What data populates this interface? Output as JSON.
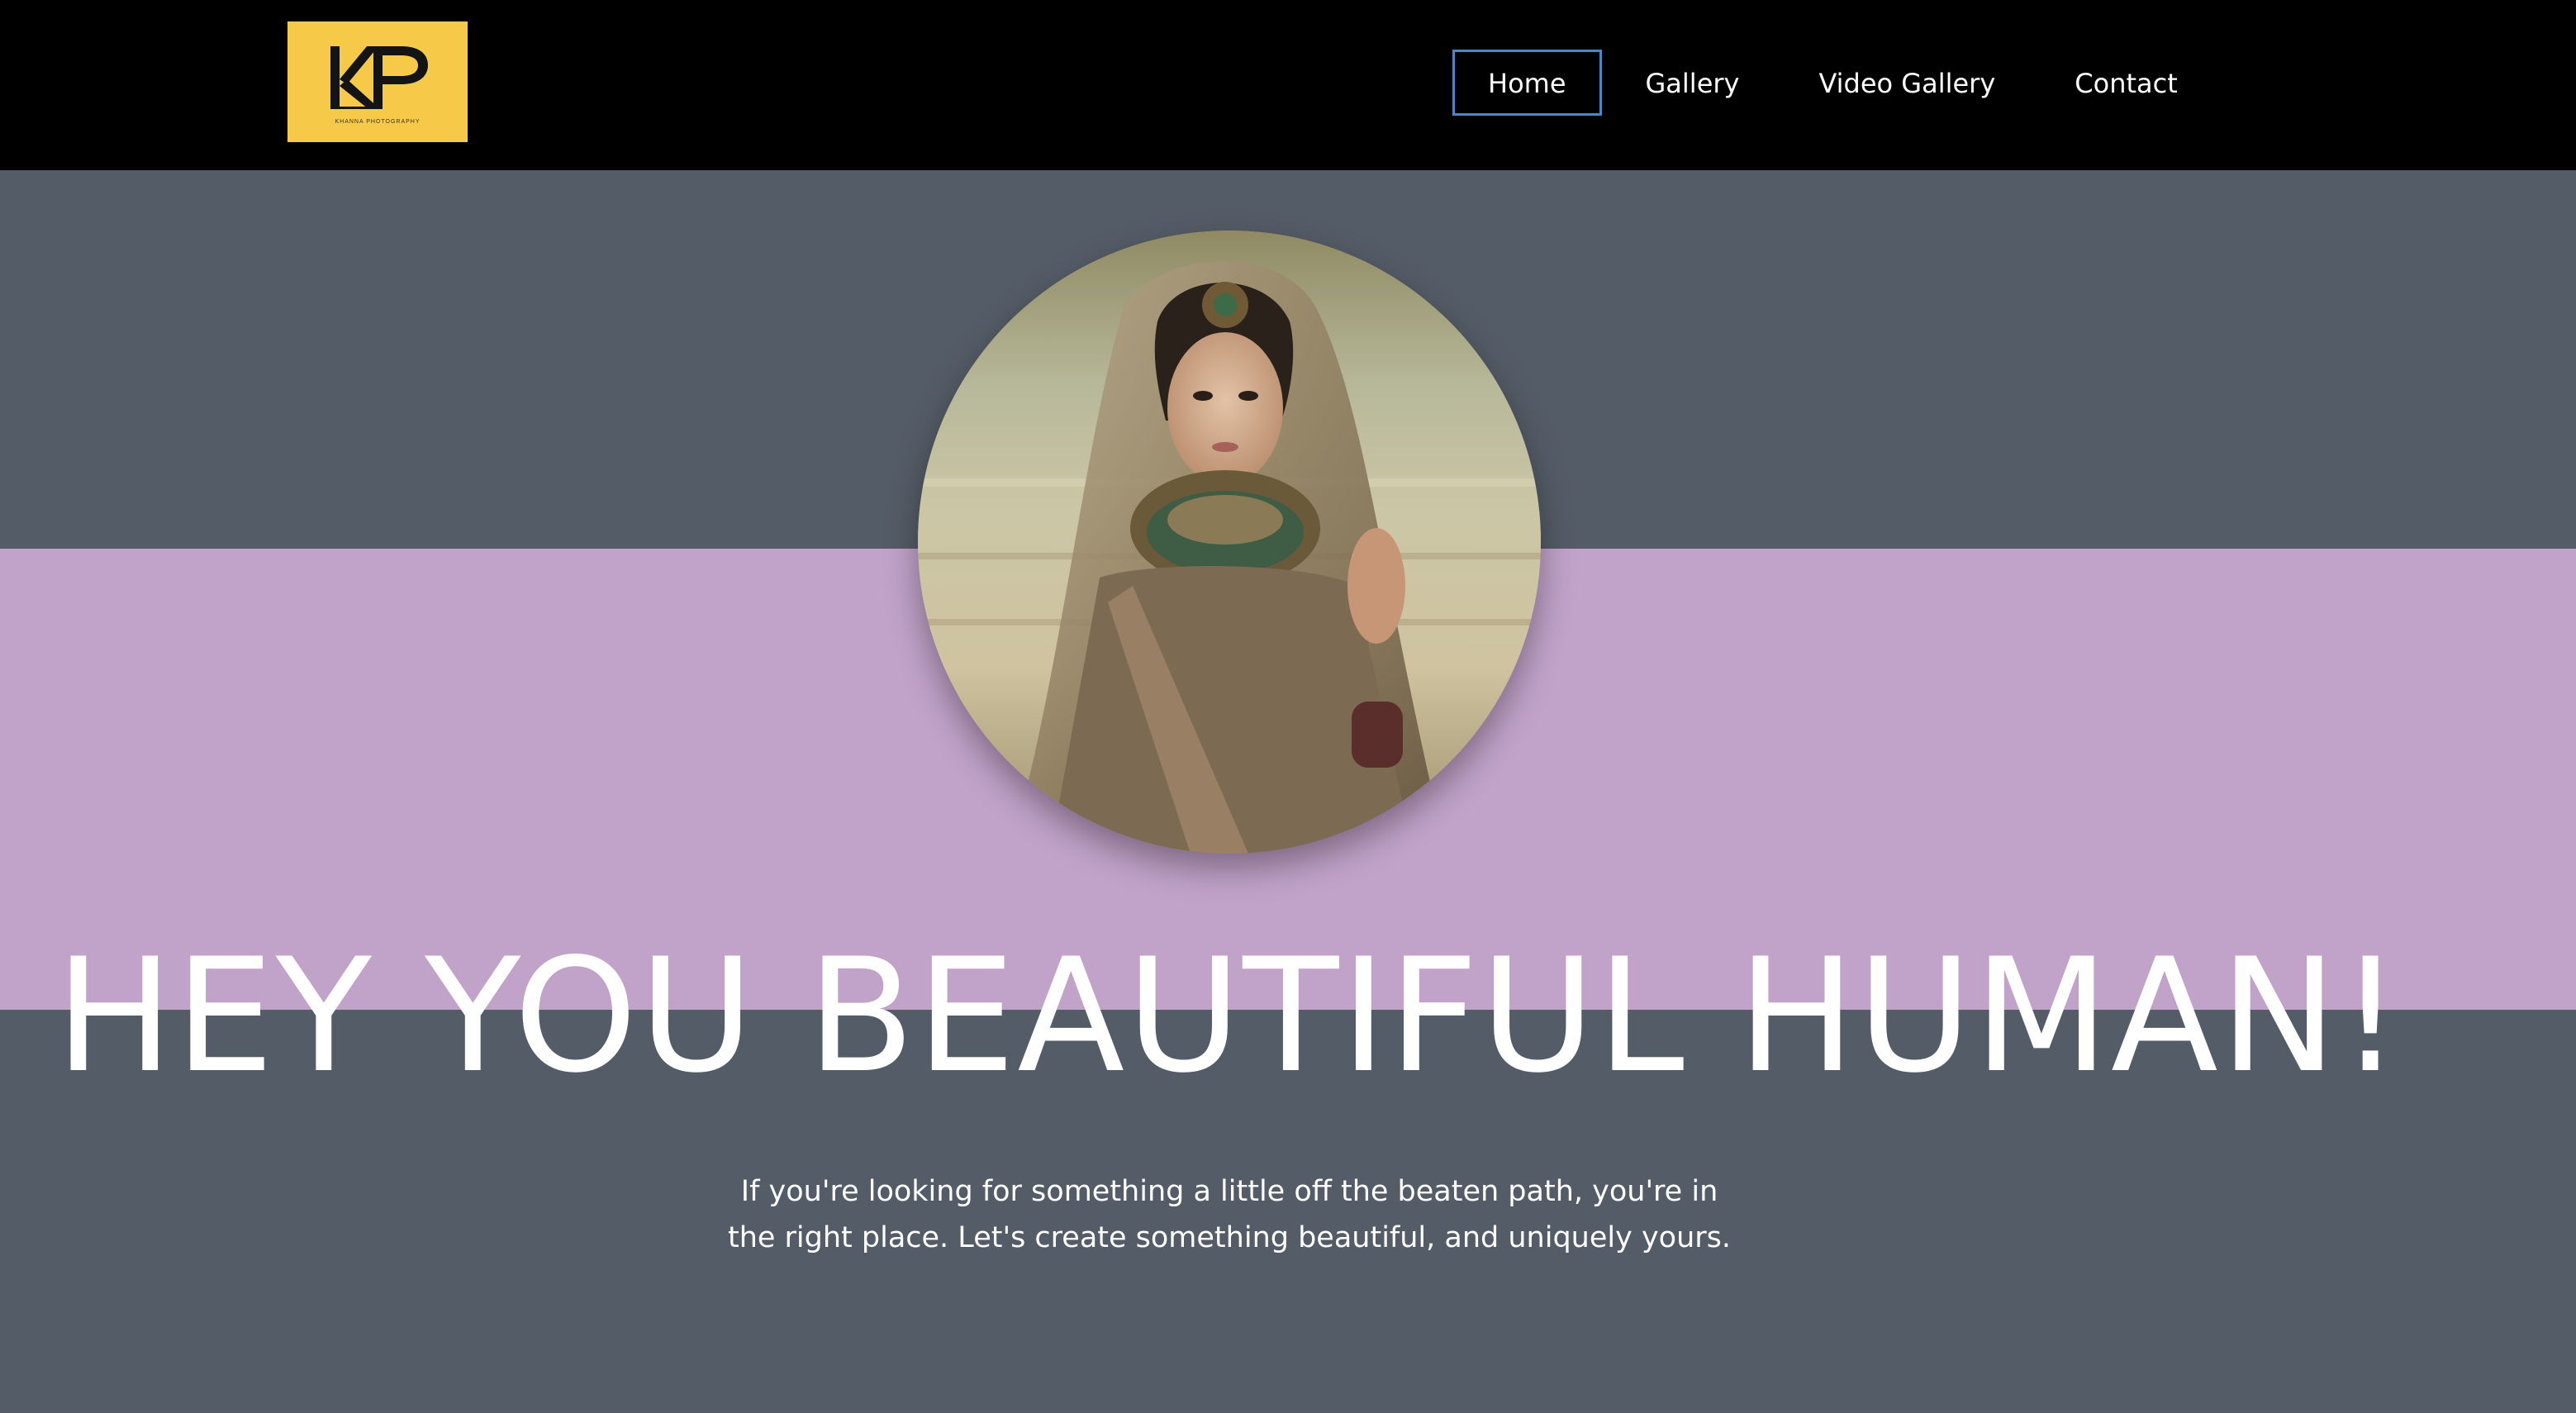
{
  "brand": {
    "logo_text": "KP",
    "logo_subtext": "KHANNA PHOTOGRAPHY"
  },
  "nav": {
    "items": [
      {
        "label": "Home",
        "active": true
      },
      {
        "label": "Gallery",
        "active": false
      },
      {
        "label": "Video Gallery",
        "active": false
      },
      {
        "label": "Contact",
        "active": false
      }
    ]
  },
  "hero": {
    "title": "HEY YOU BEAUTIFUL HUMAN!",
    "text": "If you're looking for something a little off the beaten path, you're in the right place. Let's create something beautiful, and uniquely yours."
  },
  "colors": {
    "header_bg": "#000000",
    "logo_bg": "#f7c948",
    "page_bg": "#545c67",
    "band_bg": "#c1a2c9",
    "active_border": "#4a86c8",
    "text": "#ffffff"
  }
}
